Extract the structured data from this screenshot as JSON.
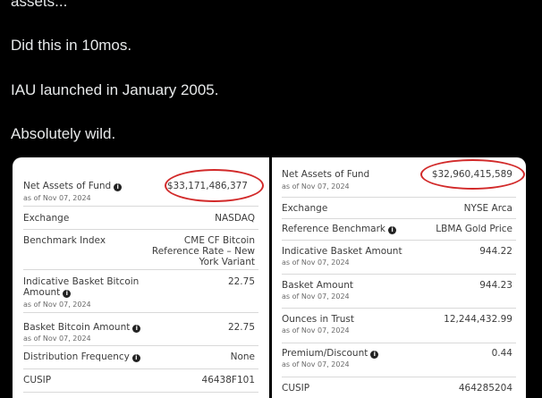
{
  "tweet": {
    "line1": "assets...",
    "line2": "Did this in 10mos.",
    "line3": "IAU launched in January 2005.",
    "line4": "Absolutely wild."
  },
  "left_card": {
    "net_assets_label": "Net Assets of Fund",
    "net_assets_date": "as of Nov 07, 2024",
    "net_assets_value": "$33,171,486,377",
    "exchange_label": "Exchange",
    "exchange_value": "NASDAQ",
    "benchmark_label": "Benchmark Index",
    "benchmark_value_1": "CME CF Bitcoin",
    "benchmark_value_2": "Reference Rate – New",
    "benchmark_value_3": "York Variant",
    "basket_label_1": "Indicative Basket Bitcoin",
    "basket_label_2": "Amount",
    "basket_date": "as of Nov 07, 2024",
    "basket_value": "22.75",
    "btc_amount_label": "Basket Bitcoin Amount",
    "btc_amount_date": "as of Nov 07, 2024",
    "btc_amount_value": "22.75",
    "distribution_label": "Distribution Frequency",
    "distribution_value": "None",
    "cusip_label": "CUSIP",
    "cusip_value": "46438F101"
  },
  "right_card": {
    "net_assets_label": "Net Assets of Fund",
    "net_assets_date": "as of Nov 07, 2024",
    "net_assets_value": "$32,960,415,589",
    "exchange_label": "Exchange",
    "exchange_value": "NYSE Arca",
    "ref_benchmark_label": "Reference Benchmark",
    "ref_benchmark_value": "LBMA Gold Price",
    "ind_basket_label": "Indicative Basket Amount",
    "ind_basket_date": "as of Nov 07, 2024",
    "ind_basket_value": "944.22",
    "basket_label": "Basket Amount",
    "basket_date": "as of Nov 07, 2024",
    "basket_value": "944.23",
    "ounces_label": "Ounces in Trust",
    "ounces_date": "as of Nov 07, 2024",
    "ounces_value": "12,244,432.99",
    "premium_label": "Premium/Discount",
    "premium_date": "as of Nov 07, 2024",
    "premium_value": "0.44",
    "cusip_label": "CUSIP",
    "cusip_value": "464285204"
  },
  "icons": {
    "info": "i",
    "highlight_color": "#d22a2a"
  }
}
